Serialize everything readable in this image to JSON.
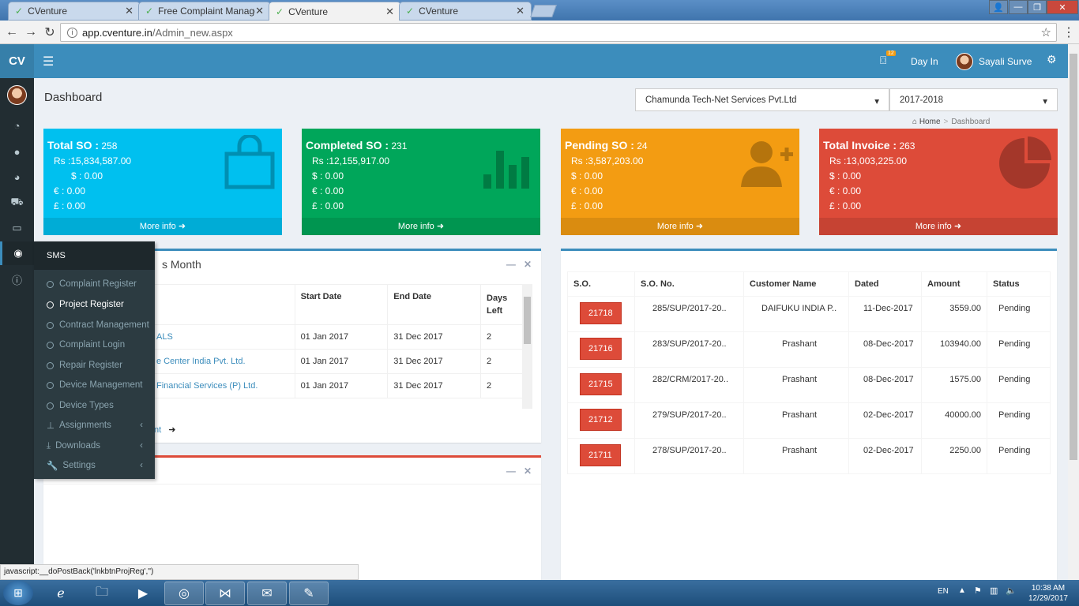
{
  "browser": {
    "tabs": [
      {
        "title": "CVenture"
      },
      {
        "title": "Free Complaint Manager"
      },
      {
        "title": "CVenture"
      },
      {
        "title": "CVenture"
      }
    ],
    "url_host": "app.cventure.in",
    "url_path": "/Admin_new.aspx",
    "status_url": "javascript:__doPostBack('lnkbtnProjReg','')"
  },
  "header": {
    "logo": "CV",
    "notification_count": "12",
    "day_in": "Day In",
    "user_name": "Sayali Surve"
  },
  "page": {
    "title": "Dashboard",
    "company_select": "Chamunda Tech-Net Services Pvt.Ltd",
    "year_select": "2017-2018",
    "breadcrumb_home": "Home",
    "breadcrumb_current": "Dashboard"
  },
  "flyout": {
    "head": "SMS",
    "items": [
      {
        "label": "Complaint Register"
      },
      {
        "label": "Project Register"
      },
      {
        "label": "Contract Management"
      },
      {
        "label": "Complaint Login"
      },
      {
        "label": "Repair Register"
      },
      {
        "label": "Device Management"
      },
      {
        "label": "Device Types"
      },
      {
        "label": "Assignments"
      },
      {
        "label": "Downloads"
      },
      {
        "label": "Settings"
      }
    ]
  },
  "boxes": [
    {
      "title": "Total SO :",
      "count": "258",
      "rs": "Rs :15,834,587.00",
      "usd": "$ :  0.00",
      "eur": "€ :  0.00",
      "gbp": "£ :  0.00",
      "more": "More info",
      "color": "#00c0ef"
    },
    {
      "title": "Completed SO :",
      "count": "231",
      "rs": "Rs :12,155,917.00",
      "usd": "$ :  0.00",
      "eur": "€ :  0.00",
      "gbp": "£ :  0.00",
      "more": "More info",
      "color": "#00a65a"
    },
    {
      "title": "Pending SO :",
      "count": "24",
      "rs": "Rs :3,587,203.00",
      "usd": "$ :  0.00",
      "eur": "€ :  0.00",
      "gbp": "£ :  0.00",
      "more": "More info",
      "color": "#f39c12"
    },
    {
      "title": "Total Invoice :",
      "count": "263",
      "rs": "Rs :13,003,225.00",
      "usd": "$ :  0.00",
      "eur": "€ :  0.00",
      "gbp": "£ :  0.00",
      "more": "More info",
      "color": "#dd4b39"
    }
  ],
  "projects": {
    "title_partial": "s Month",
    "headers": [
      "Start Date",
      "End Date",
      "Days Left"
    ],
    "rows": [
      {
        "name": "ALS",
        "start": "01 Jan 2017",
        "end": "31 Dec 2017",
        "days": "2"
      },
      {
        "name": "e Center India Pvt. Ltd.",
        "start": "01 Jan 2017",
        "end": "31 Dec 2017",
        "days": "2"
      },
      {
        "name": "Financial Services (P) Ltd.",
        "start": "01 Jan 2017",
        "end": "31 Dec 2017",
        "days": "2"
      }
    ],
    "footer_partial": "nt"
  },
  "so_table": {
    "headers": [
      "S.O.",
      "S.O. No.",
      "Customer Name",
      "Dated",
      "Amount",
      "Status"
    ],
    "rows": [
      {
        "so": "21718",
        "no": "285/SUP/2017-20..",
        "customer": "DAIFUKU INDIA P..",
        "dated": "11-Dec-2017",
        "amount": "3559.00",
        "status": "Pending"
      },
      {
        "so": "21716",
        "no": "283/SUP/2017-20..",
        "customer": "Prashant",
        "dated": "08-Dec-2017",
        "amount": "103940.00",
        "status": "Pending"
      },
      {
        "so": "21715",
        "no": "282/CRM/2017-20..",
        "customer": "Prashant",
        "dated": "08-Dec-2017",
        "amount": "1575.00",
        "status": "Pending"
      },
      {
        "so": "21712",
        "no": "279/SUP/2017-20..",
        "customer": "Prashant",
        "dated": "02-Dec-2017",
        "amount": "40000.00",
        "status": "Pending"
      },
      {
        "so": "21711",
        "no": "278/SUP/2017-20..",
        "customer": "Prashant",
        "dated": "02-Dec-2017",
        "amount": "2250.00",
        "status": "Pending"
      }
    ]
  },
  "taskbar": {
    "lang": "EN",
    "time": "10:38 AM",
    "date": "12/29/2017"
  }
}
